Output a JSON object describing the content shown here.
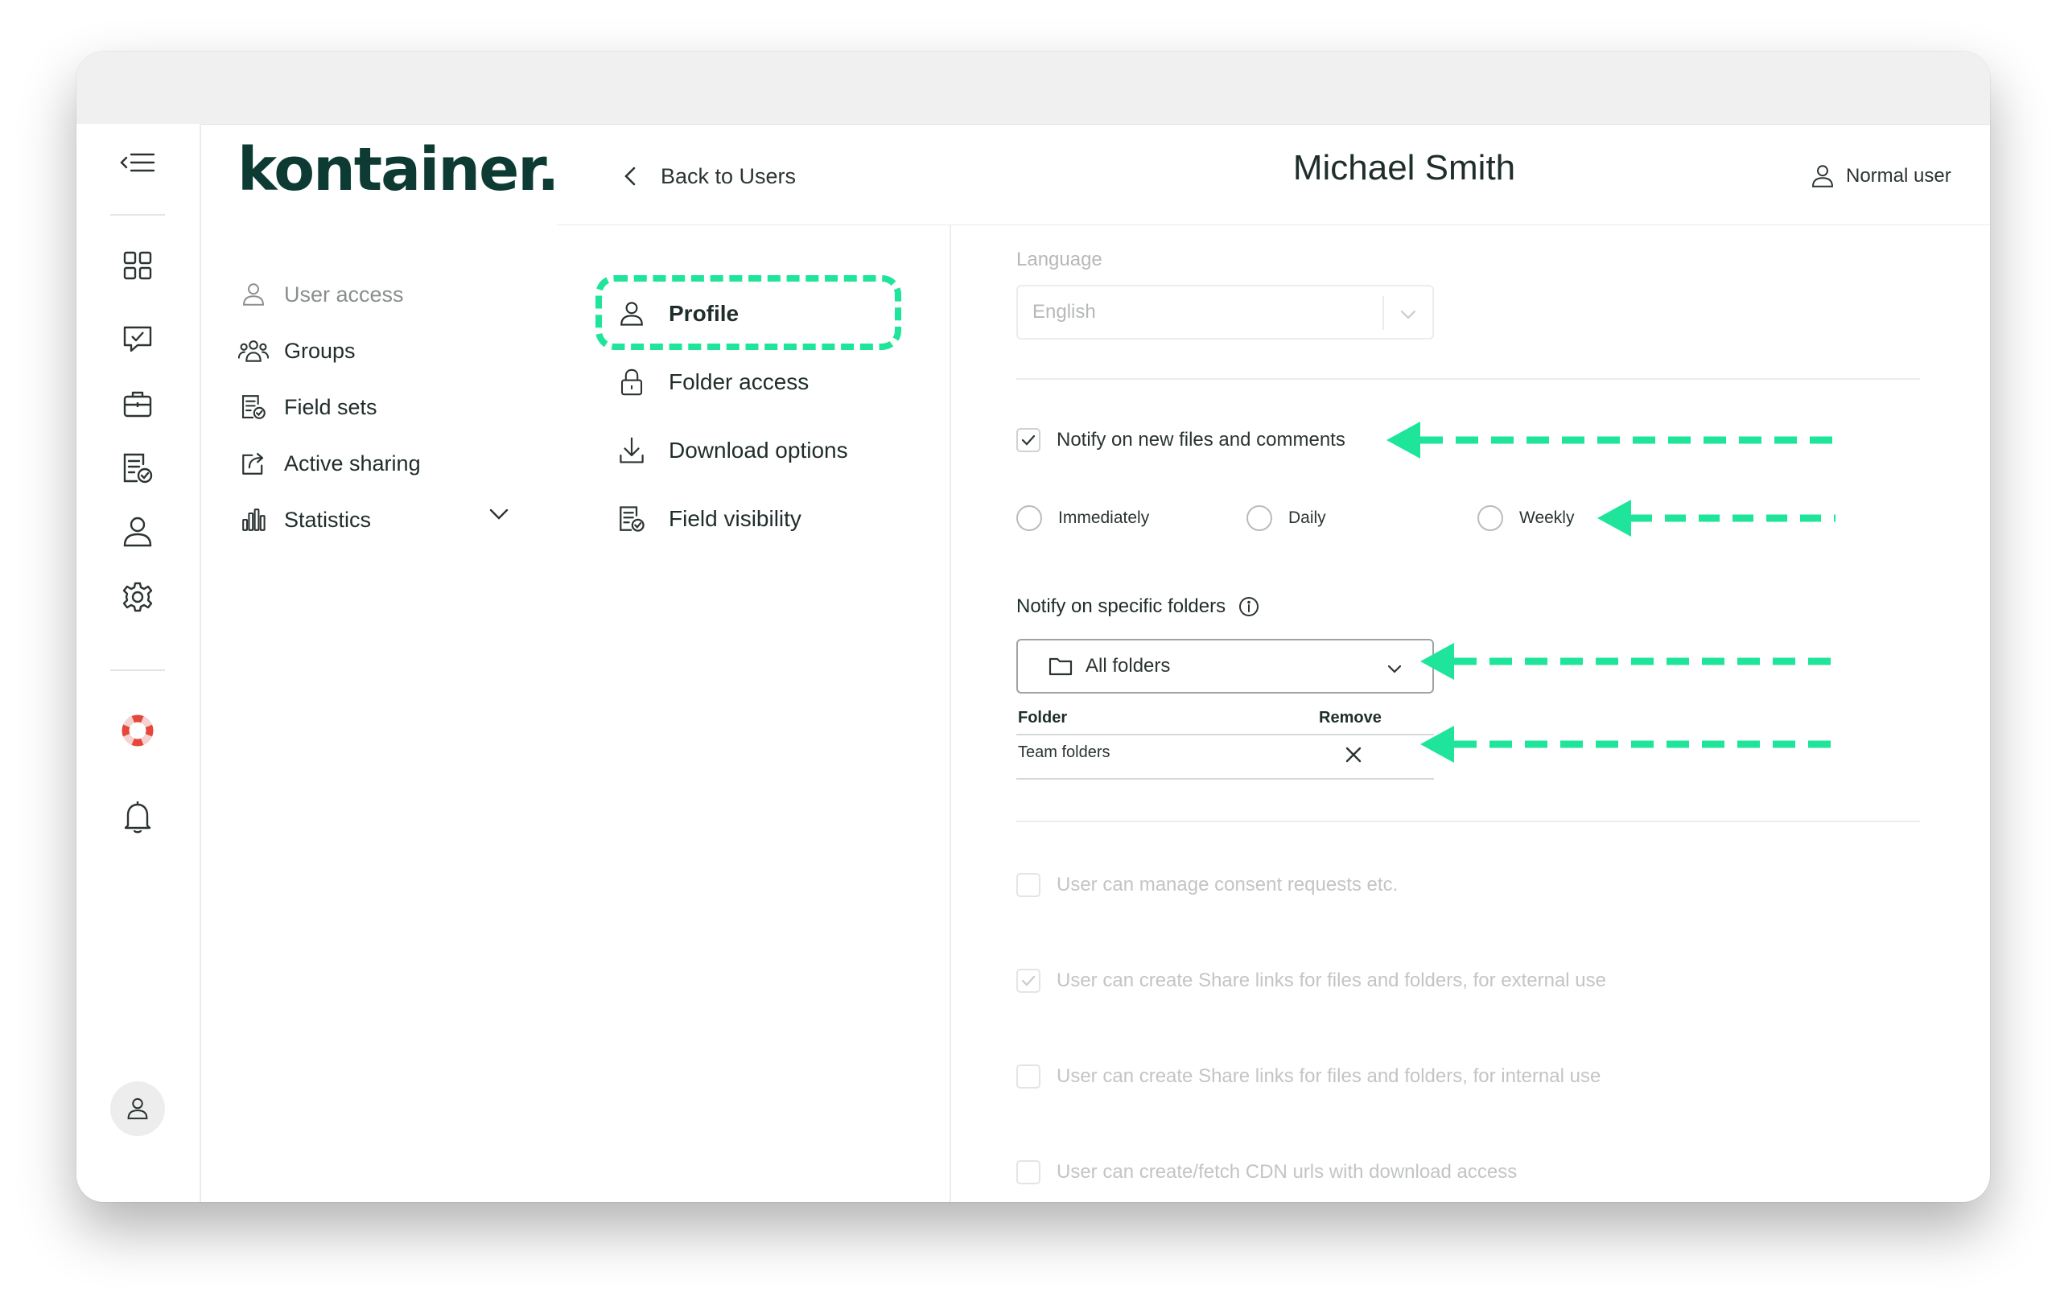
{
  "app": {
    "logo_text": "kontainer.",
    "page_title": "Michael Smith",
    "user_role": "Normal user",
    "back_label": "Back to Users"
  },
  "rail": {
    "icons": [
      "collapse-menu-icon",
      "grid-icon",
      "chat-check-icon",
      "briefcase-icon",
      "document-check-icon",
      "user-icon",
      "gear-icon",
      "lifebuoy-icon",
      "bell-icon",
      "avatar-icon"
    ]
  },
  "nav": {
    "items": [
      {
        "label": "User access",
        "icon": "user-icon"
      },
      {
        "label": "Groups",
        "icon": "users-icon"
      },
      {
        "label": "Field sets",
        "icon": "document-check-icon"
      },
      {
        "label": "Active sharing",
        "icon": "share-icon"
      },
      {
        "label": "Statistics",
        "icon": "bar-chart-icon"
      }
    ]
  },
  "tabs": [
    {
      "label": "Profile",
      "icon": "user-icon",
      "active": true
    },
    {
      "label": "Folder access",
      "icon": "lock-icon"
    },
    {
      "label": "Download options",
      "icon": "download-icon"
    },
    {
      "label": "Field visibility",
      "icon": "document-check-icon"
    }
  ],
  "profile": {
    "language_label": "Language",
    "language_value": "English",
    "notify_label": "Notify on new files and comments",
    "notify_checked": true,
    "frequency_options": [
      "Immediately",
      "Daily",
      "Weekly"
    ],
    "folders_label": "Notify on specific folders",
    "folders_select": "All folders",
    "table": {
      "headers": [
        "Folder",
        "Remove"
      ],
      "rows": [
        {
          "folder": "Team folders"
        }
      ]
    },
    "permissions": [
      {
        "label": "User can manage consent requests etc.",
        "checked": false
      },
      {
        "label": "User can create Share links for files and folders, for external use",
        "checked": true
      },
      {
        "label": "User can create Share links for files and folders, for internal use",
        "checked": false
      },
      {
        "label": "User can create/fetch CDN urls with download access",
        "checked": false
      }
    ]
  },
  "colors": {
    "brand": "#0d3b33",
    "highlight": "#1ee59a",
    "lifebuoy": "#e5473b"
  }
}
